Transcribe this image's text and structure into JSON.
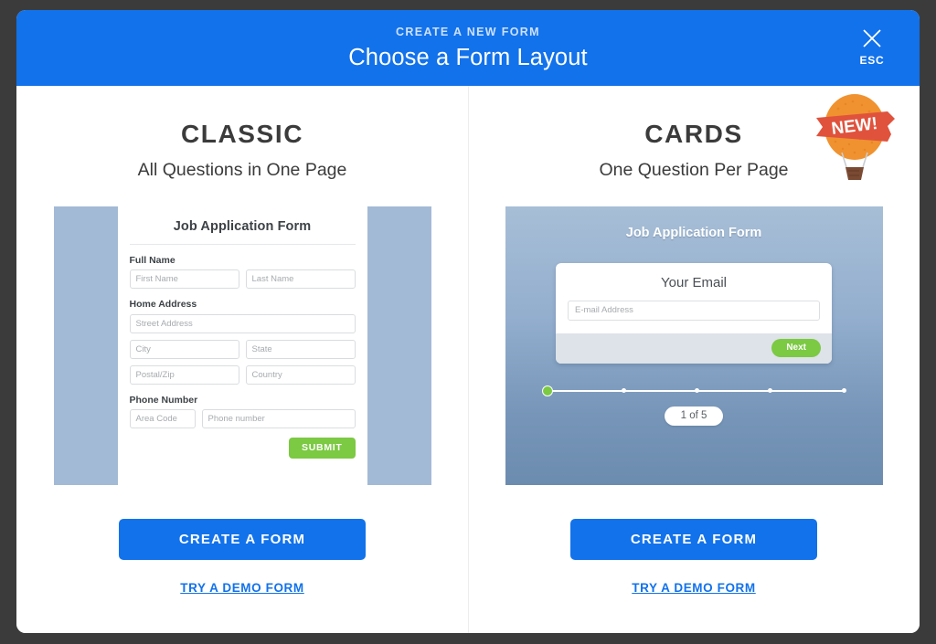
{
  "header": {
    "eyebrow": "CREATE A NEW FORM",
    "title": "Choose a Form Layout",
    "esc_label": "ESC",
    "background_color": "#1272EB"
  },
  "panels": {
    "classic": {
      "title": "CLASSIC",
      "subtitle": "All Questions in One Page",
      "cta_label": "CREATE A FORM",
      "demo_link_label": "TRY A DEMO FORM",
      "mockup": {
        "form_title": "Job Application Form",
        "frame_color": "#A3BAD6",
        "groups": [
          {
            "label": "Full Name",
            "fields": [
              "First Name",
              "Last Name"
            ]
          },
          {
            "label": "Home Address",
            "fields": [
              "Street Address",
              "City",
              "State",
              "Postal/Zip",
              "Country"
            ]
          },
          {
            "label": "Phone Number",
            "fields": [
              "Area Code",
              "Phone number"
            ]
          }
        ],
        "submit_label": "SUBMIT",
        "submit_color": "#7CC943"
      }
    },
    "cards": {
      "title": "CARDS",
      "subtitle": "One Question Per Page",
      "badge_label": "NEW!",
      "badge_colors": {
        "balloon": "#F0922F",
        "banner": "#E0523C",
        "basket": "#7A4A32"
      },
      "cta_label": "CREATE A FORM",
      "demo_link_label": "TRY A DEMO FORM",
      "mockup": {
        "form_title": "Job Application Form",
        "question_title": "Your Email",
        "email_placeholder": "E-mail Address",
        "next_label": "Next",
        "next_color": "#7CC943",
        "progress": {
          "current_step": 1,
          "total_steps": 5,
          "counter_label": "1 of 5",
          "dots": [
            true,
            false,
            false,
            false,
            false
          ]
        }
      }
    }
  }
}
